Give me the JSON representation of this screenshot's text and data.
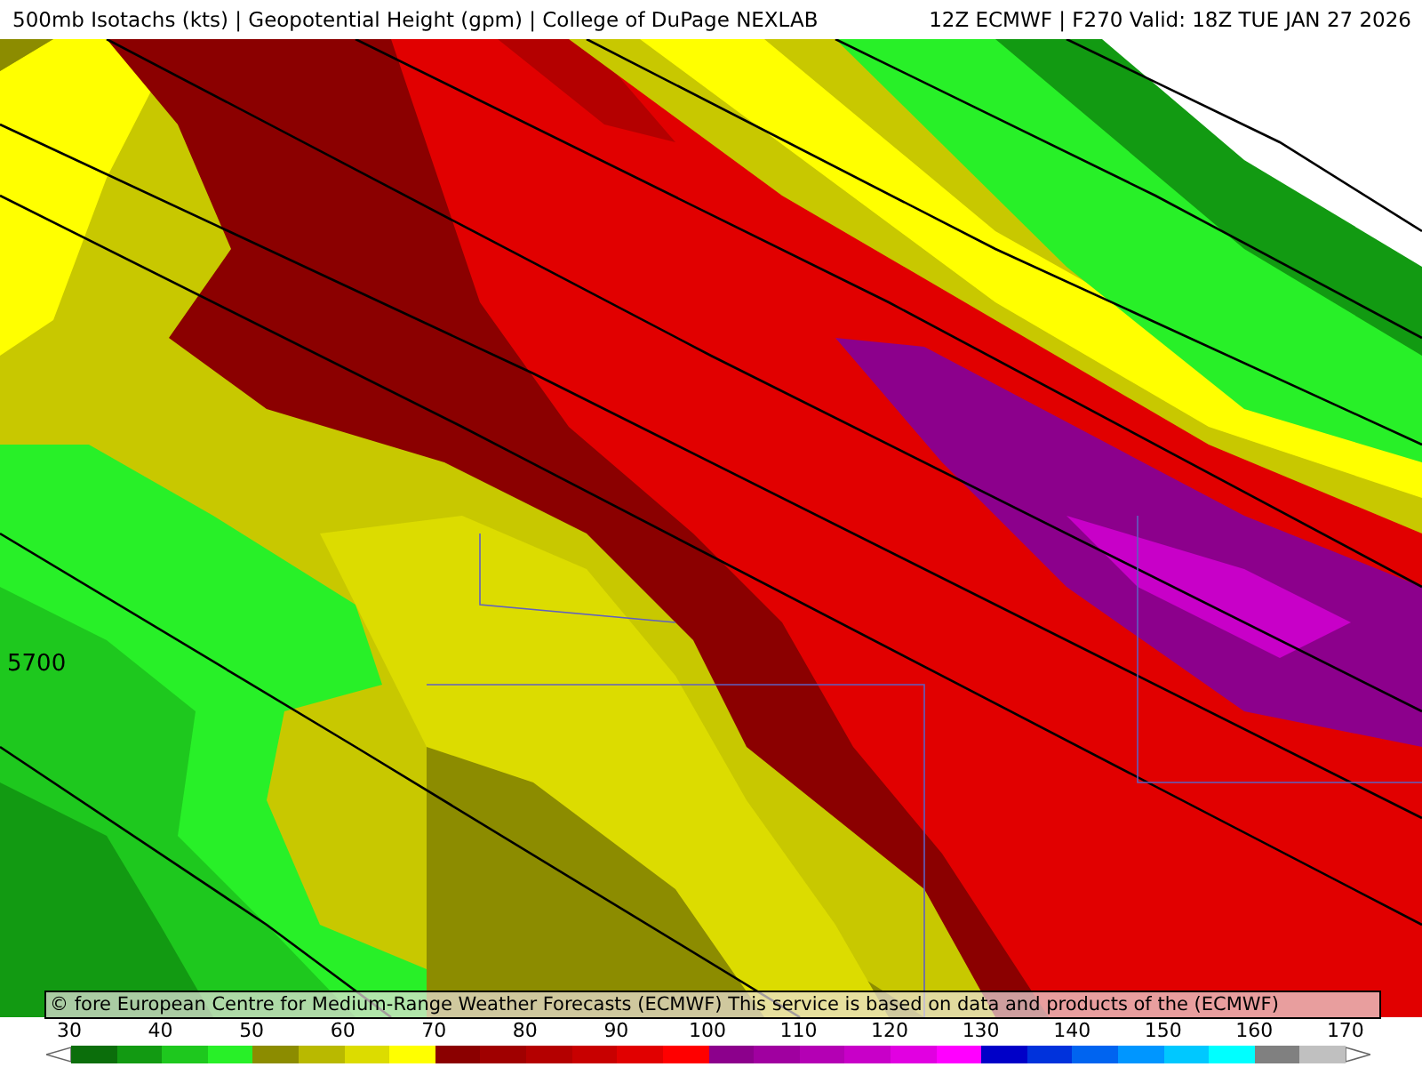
{
  "header": {
    "title_left": "500mb Isotachs (kts) | Geopotential Height (gpm) | College of DuPage NEXLAB",
    "title_right": "12Z ECMWF | F270 Valid: 18Z TUE JAN 27 2026"
  },
  "map": {
    "contour_label": "5700",
    "attribution": "© fore European Centre for Medium-Range Weather Forecasts (ECMWF)  This service is based on data and products of the (ECMWF)"
  },
  "colorbar": {
    "labels": [
      "30",
      "40",
      "50",
      "60",
      "70",
      "80",
      "90",
      "100",
      "110",
      "120",
      "130",
      "140",
      "150",
      "160",
      "170"
    ],
    "segments": [
      {
        "color": "#0b6e0b"
      },
      {
        "color": "#129a12"
      },
      {
        "color": "#1ec81e"
      },
      {
        "color": "#28f028"
      },
      {
        "color": "#8c8c00"
      },
      {
        "color": "#b9b900"
      },
      {
        "color": "#dcdc00"
      },
      {
        "color": "#ffff00"
      },
      {
        "color": "#8b0000"
      },
      {
        "color": "#a00000"
      },
      {
        "color": "#b40000"
      },
      {
        "color": "#c80000"
      },
      {
        "color": "#e10000"
      },
      {
        "color": "#ff0000"
      },
      {
        "color": "#8c008c"
      },
      {
        "color": "#a000a0"
      },
      {
        "color": "#b400b4"
      },
      {
        "color": "#c800c8"
      },
      {
        "color": "#e100e1"
      },
      {
        "color": "#ff00ff"
      },
      {
        "color": "#0000c8"
      },
      {
        "color": "#0032dc"
      },
      {
        "color": "#0064f0"
      },
      {
        "color": "#0096ff"
      },
      {
        "color": "#00c8ff"
      },
      {
        "color": "#00ffff"
      },
      {
        "color": "#808080"
      },
      {
        "color": "#c0c0c0"
      }
    ]
  }
}
